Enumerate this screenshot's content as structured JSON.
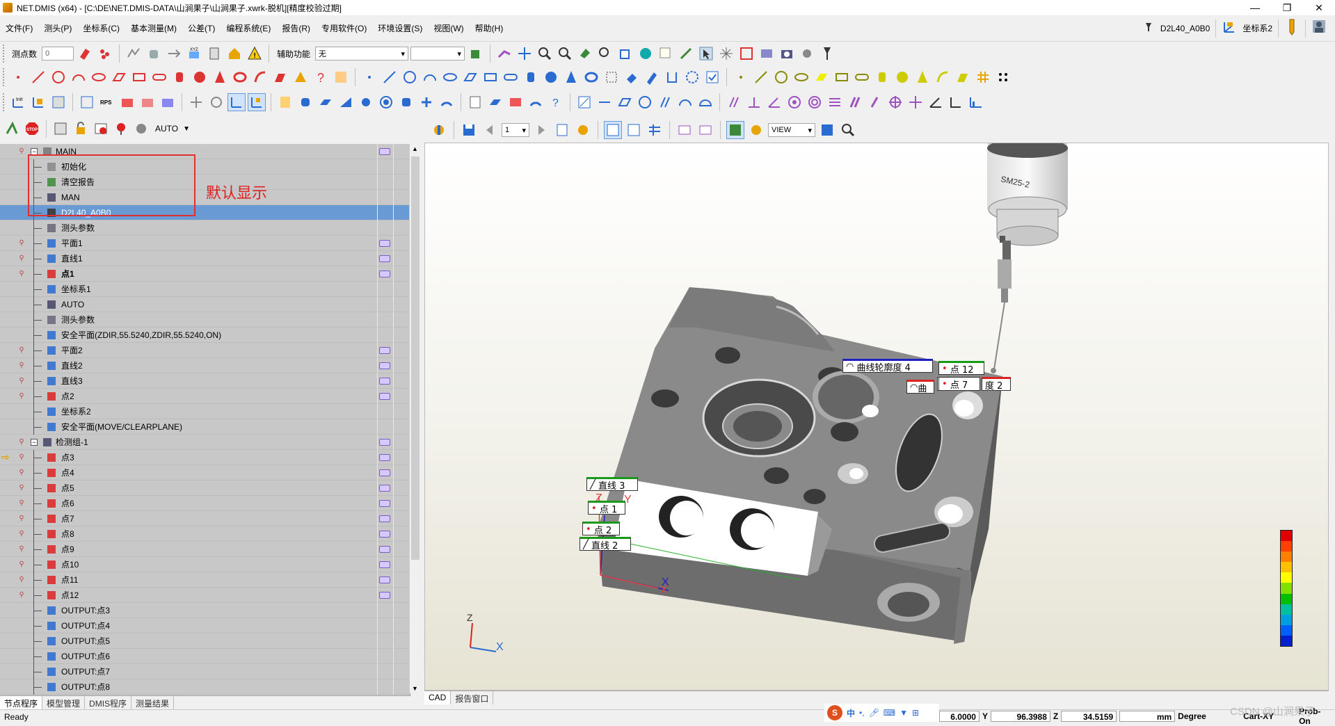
{
  "window": {
    "title": "NET.DMIS (x64) - [C:\\DE\\NET.DMIS-DATA\\山涧果子\\山涧果子.xwrk-脱机][精度校验过期]",
    "controls": [
      "—",
      "❐",
      "✕"
    ]
  },
  "menu": {
    "items": [
      "文件(F)",
      "测头(P)",
      "坐标系(C)",
      "基本测量(M)",
      "公差(T)",
      "编程系统(E)",
      "报告(R)",
      "专用软件(O)",
      "环境设置(S)",
      "视图(W)",
      "帮助(H)"
    ],
    "probe_label": "D2L40_A0B0",
    "coord_label": "坐标系2"
  },
  "toolbar1": {
    "point_count_label": "测点数",
    "point_count_value": "0",
    "aux_label": "辅助功能",
    "aux_value": "无"
  },
  "toolbar4": {
    "mode_value": "AUTO"
  },
  "viewtoolbar": {
    "page_value": "1",
    "view_value": "VIEW"
  },
  "tree": {
    "rows": [
      {
        "text": "MAIN",
        "bold": false
      },
      {
        "text": "初始化"
      },
      {
        "text": "清空报告"
      },
      {
        "text": "MAN"
      },
      {
        "text": "D2L40_A0B0"
      },
      {
        "text": "测头参数"
      },
      {
        "text": "平面1"
      },
      {
        "text": "直线1"
      },
      {
        "text": "点1"
      },
      {
        "text": "坐标系1"
      },
      {
        "text": "AUTO"
      },
      {
        "text": "测头参数"
      },
      {
        "text": "安全平面(ZDIR,55.5240,ZDIR,55.5240,ON)"
      },
      {
        "text": "平面2"
      },
      {
        "text": "直线2"
      },
      {
        "text": "直线3"
      },
      {
        "text": "点2"
      },
      {
        "text": "坐标系2"
      },
      {
        "text": "安全平面(MOVE/CLEARPLANE)"
      },
      {
        "text": "检测组-1"
      },
      {
        "text": "点3"
      },
      {
        "text": "点4"
      },
      {
        "text": "点5"
      },
      {
        "text": "点6"
      },
      {
        "text": "点7"
      },
      {
        "text": "点8"
      },
      {
        "text": "点9"
      },
      {
        "text": "点10"
      },
      {
        "text": "点11"
      },
      {
        "text": "点12"
      },
      {
        "text": "OUTPUT:点3"
      },
      {
        "text": "OUTPUT:点4"
      },
      {
        "text": "OUTPUT:点5"
      },
      {
        "text": "OUTPUT:点6"
      },
      {
        "text": "OUTPUT:点7"
      },
      {
        "text": "OUTPUT:点8"
      }
    ],
    "annotation": "默认显示"
  },
  "left_tabs": [
    "节点程序",
    "模型管理",
    "DMIS程序",
    "测量结果"
  ],
  "cad_tabs": [
    "CAD",
    "报告窗口"
  ],
  "viewport": {
    "probe_name": "SM25-2",
    "labels": {
      "curve4": "曲线轮廓度 4",
      "curve2a": "曲",
      "curve2b": "度 2",
      "pt12": "点 12",
      "pt7": "点 7",
      "line3": "直线 3",
      "pt1": "点 1",
      "pt2": "点 2",
      "line2": "直线 2"
    },
    "axis": {
      "x": "X",
      "y": "Y",
      "z": "Z"
    },
    "legend_colors": [
      "#e00000",
      "#ff4000",
      "#ff8000",
      "#ffc000",
      "#ffff00",
      "#80e000",
      "#00c000",
      "#00c0a0",
      "#00a0e0",
      "#0060ff",
      "#0020d0"
    ]
  },
  "status": {
    "ready": "Ready",
    "x_value": "6.0000",
    "y_label": "Y",
    "y_value": "96.3988",
    "z_label": "Z",
    "z_value": "34.5159",
    "unit": "mm",
    "angle": "Degree",
    "cart": "Cart-XY",
    "prob": "Prob-On",
    "watermark": "CSDN @山涧果子"
  }
}
